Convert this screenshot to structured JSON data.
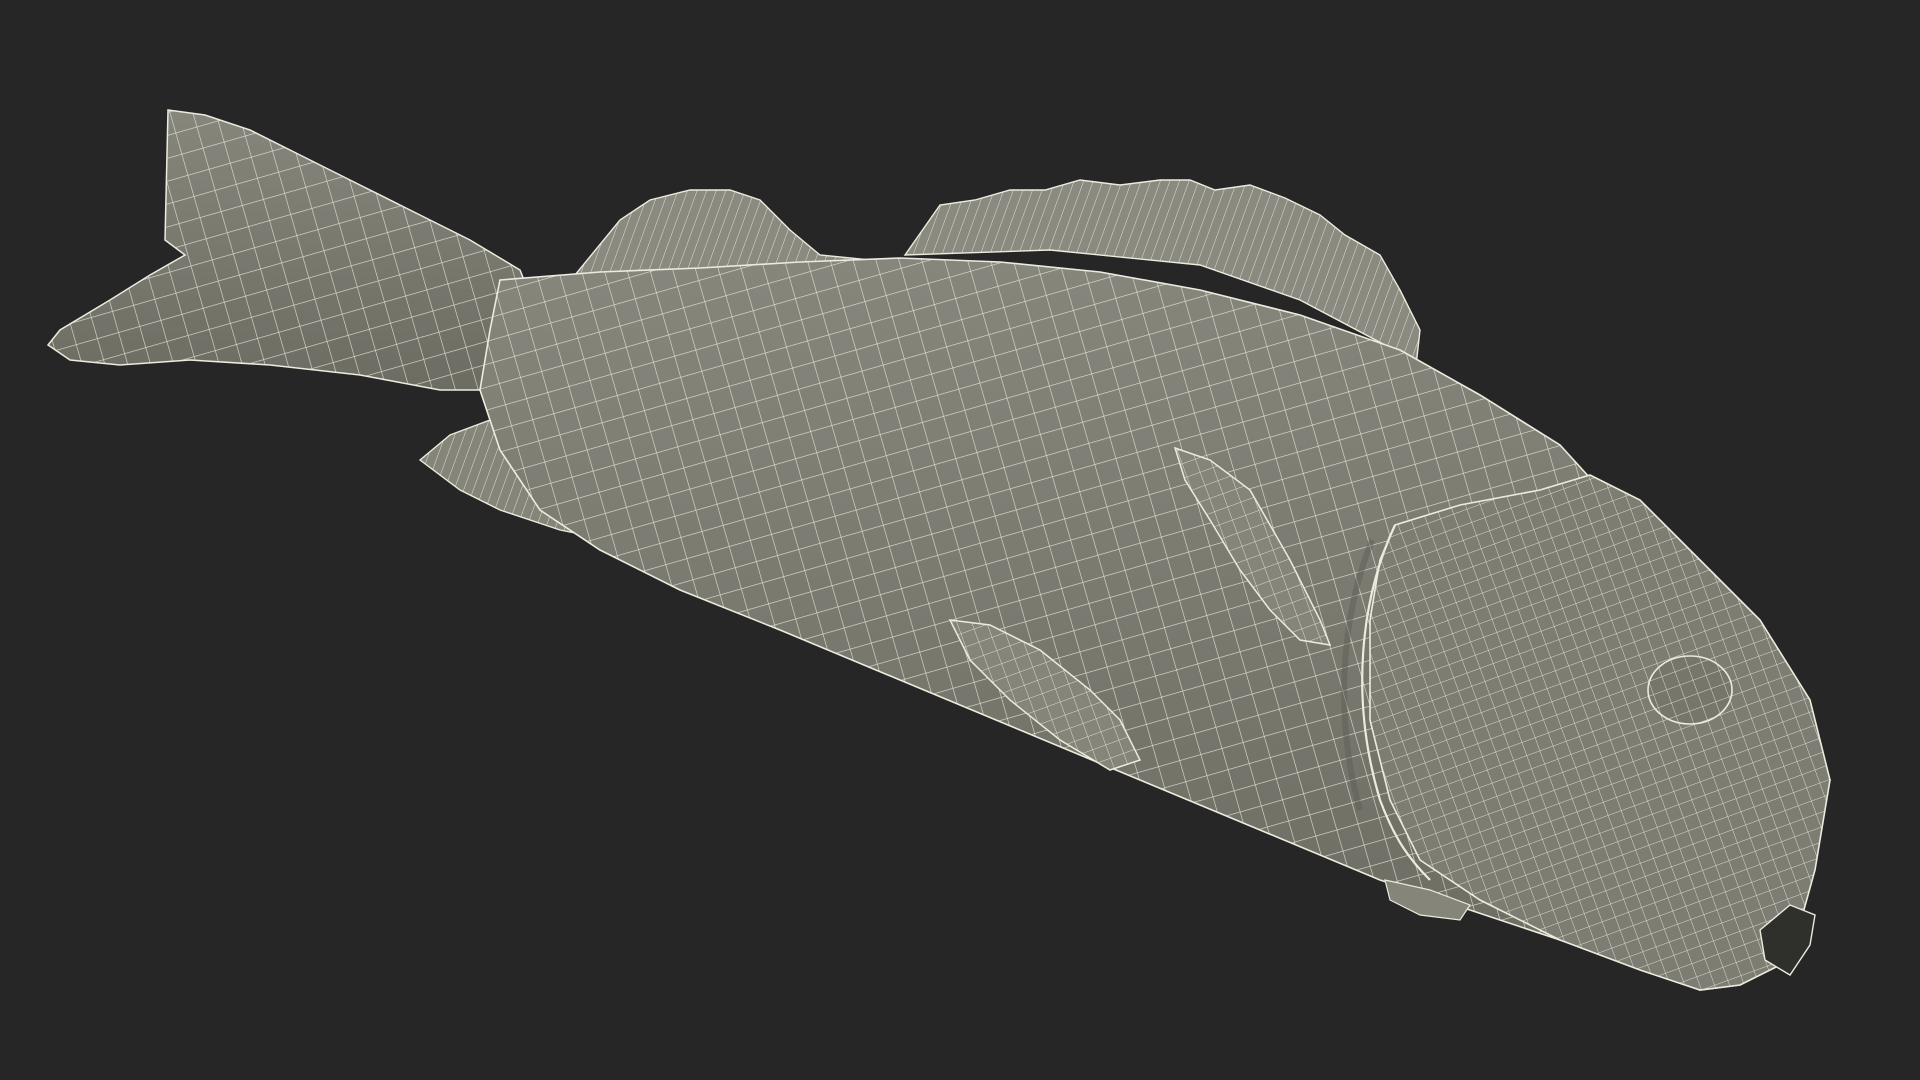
{
  "scene": {
    "subject": "fish-wireframe-model",
    "colors": {
      "background": "#262626",
      "body": "#7a7a70",
      "body_shadow": "#66665d",
      "fin": "#86867b",
      "wire": "#ecebdd"
    }
  }
}
